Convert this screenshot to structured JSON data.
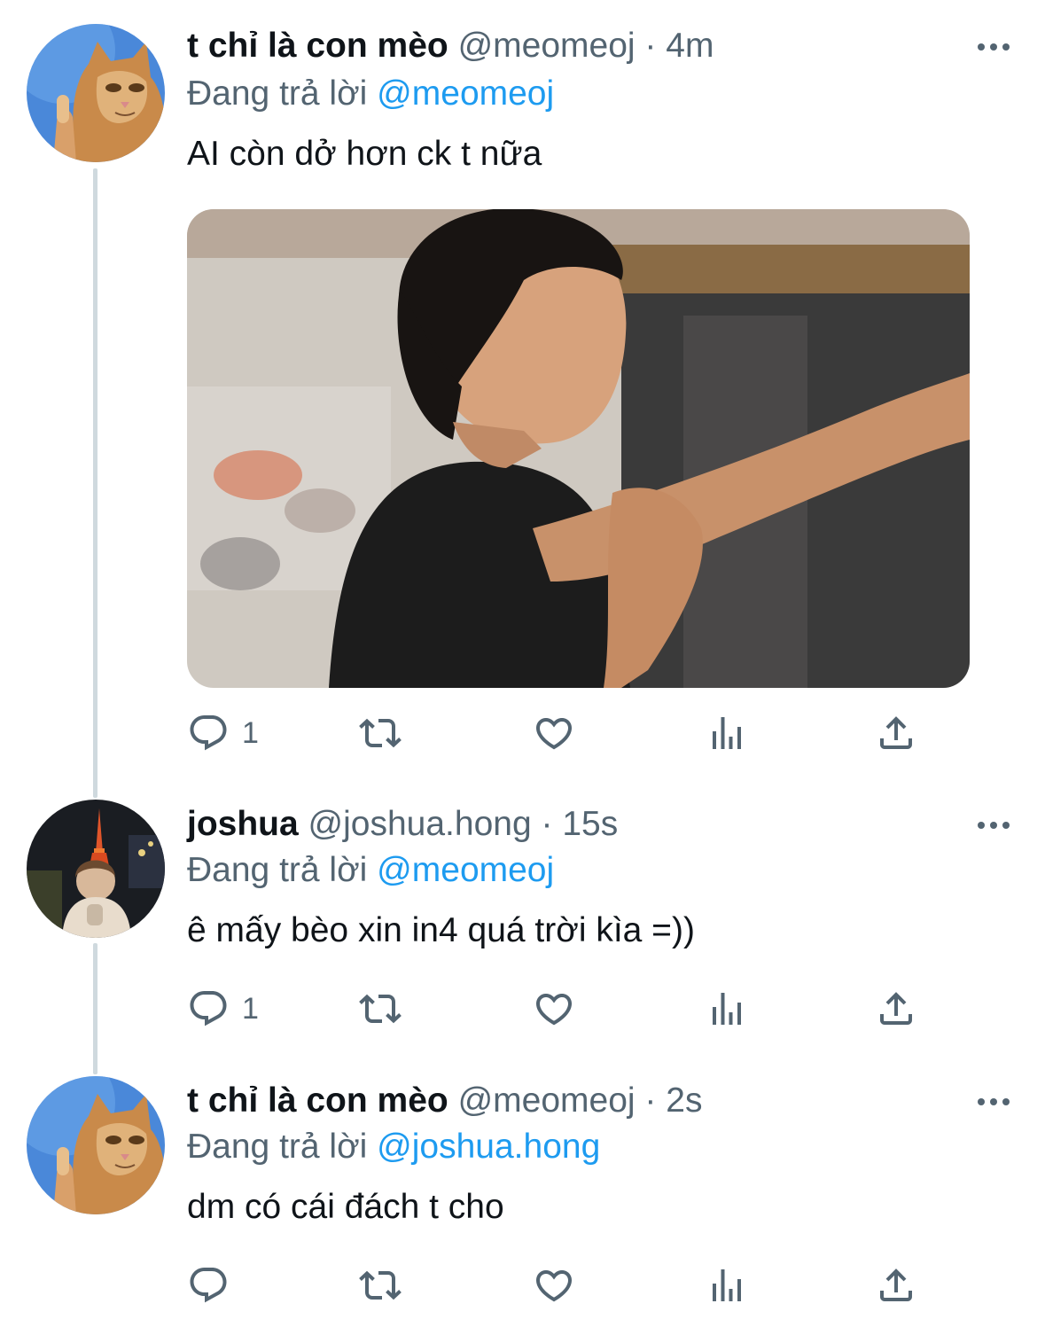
{
  "colors": {
    "accent": "#1d9bf0",
    "secondary_text": "#536471",
    "thread_line": "#cfd9de"
  },
  "tweets": [
    {
      "name": "t chỉ là con mèo",
      "handle": "@meomeoj",
      "separator": "·",
      "time": "4m",
      "replying_label": "Đang trả lời",
      "replying_to": "@meomeoj",
      "text": "AI còn dở hơn ck t nữa",
      "avatar": "cat-avatar",
      "has_media": true,
      "reply_count": "1"
    },
    {
      "name": "joshua",
      "handle": "@joshua.hong",
      "separator": "·",
      "time": "15s",
      "replying_label": "Đang trả lời",
      "replying_to": "@meomeoj",
      "text": "ê mấy bèo xin in4 quá trời kìa =))",
      "avatar": "night-tower-avatar",
      "has_media": false,
      "reply_count": "1"
    },
    {
      "name": "t chỉ là con mèo",
      "handle": "@meomeoj",
      "separator": "·",
      "time": "2s",
      "replying_label": "Đang trả lời",
      "replying_to": "@joshua.hong",
      "text": "dm có cái đách t cho",
      "avatar": "cat-avatar",
      "has_media": false,
      "reply_count": ""
    }
  ],
  "icons": {
    "reply": "reply-icon",
    "retweet": "retweet-icon",
    "like": "like-icon",
    "views": "views-icon",
    "share": "share-icon",
    "more": "more-icon"
  }
}
